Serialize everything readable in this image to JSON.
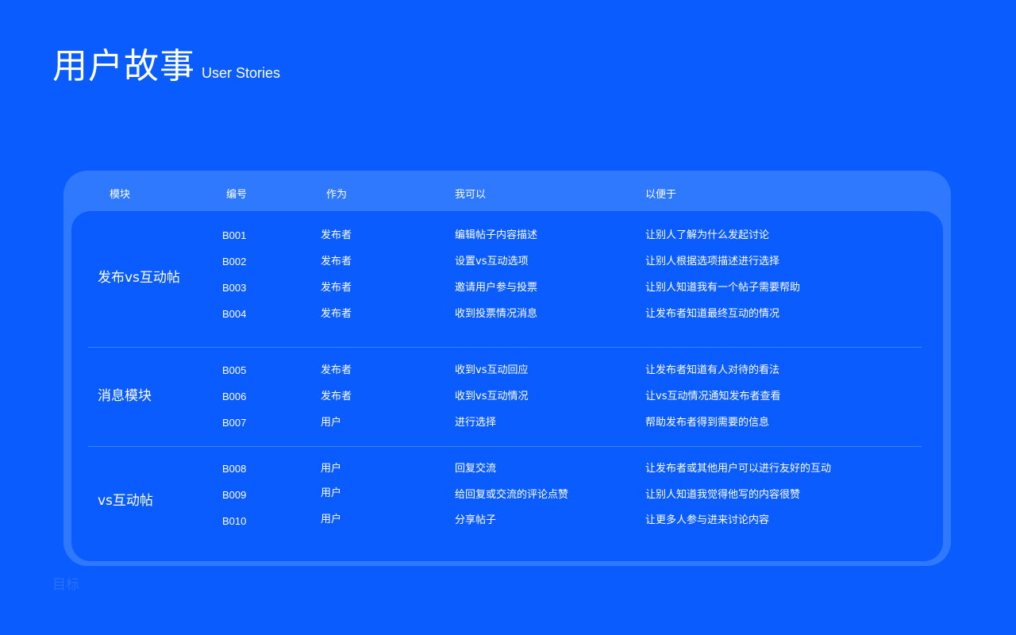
{
  "title": {
    "cn": "用户故事",
    "en": "User Stories"
  },
  "faded_label": "目标",
  "table": {
    "headers": {
      "module": "模块",
      "id": "编号",
      "as": "作为",
      "can": "我可以",
      "so_that": "以便于"
    },
    "groups": [
      {
        "module": "发布vs互动帖",
        "rows": [
          {
            "id": "B001",
            "as": "发布者",
            "can": "编辑帖子内容描述",
            "so_that": "让别人了解为什么发起讨论"
          },
          {
            "id": "B002",
            "as": "发布者",
            "can": "设置vs互动选项",
            "so_that": "让别人根据选项描述进行选择"
          },
          {
            "id": "B003",
            "as": "发布者",
            "can": "邀请用户参与投票",
            "so_that": "让别人知道我有一个帖子需要帮助"
          },
          {
            "id": "B004",
            "as": "发布者",
            "can": "收到投票情况消息",
            "so_that": "让发布者知道最终互动的情况"
          }
        ]
      },
      {
        "module": "消息模块",
        "rows": [
          {
            "id": "B005",
            "as": "发布者",
            "can": "收到vs互动回应",
            "so_that": "让发布者知道有人对待的看法"
          },
          {
            "id": "B006",
            "as": "发布者",
            "can": "收到vs互动情况",
            "so_that": "让vs互动情况通知发布者查看"
          },
          {
            "id": "B007",
            "as": "用户",
            "can": "进行选择",
            "so_that": "帮助发布者得到需要的信息"
          }
        ]
      },
      {
        "module": "vs互动帖",
        "rows": [
          {
            "id": "B008",
            "as": "用户",
            "can": "回复交流",
            "so_that": "让发布者或其他用户可以进行友好的互动"
          },
          {
            "id": "B009",
            "as": "用户",
            "can": "给回复或交流的评论点赞",
            "so_that": "让别人知道我觉得他写的内容很赞"
          },
          {
            "id": "B010",
            "as": "用户",
            "can": "分享帖子",
            "so_that": "让更多人参与进来讨论内容"
          }
        ]
      }
    ]
  }
}
